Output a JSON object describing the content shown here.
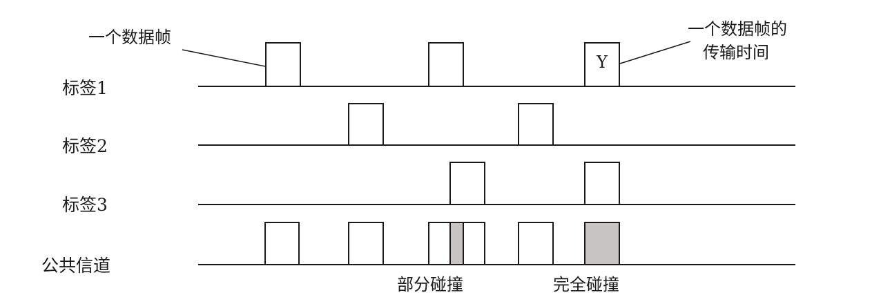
{
  "annotations": {
    "frame_label": "一个数据帧",
    "transmission_time_line1": "一个数据帧的",
    "transmission_time_line2": "传输时间",
    "frame_letter": "Y",
    "partial_collision": "部分碰撞",
    "full_collision": "完全碰撞"
  },
  "rows": [
    {
      "label": "标签1",
      "frames": [
        {
          "slot": "A"
        },
        {
          "slot": "C"
        },
        {
          "slot": "E",
          "letter": true
        }
      ]
    },
    {
      "label": "标签2",
      "frames": [
        {
          "slot": "B"
        },
        {
          "slot": "D"
        }
      ]
    },
    {
      "label": "标签3",
      "frames": [
        {
          "slot": "C2"
        },
        {
          "slot": "E"
        }
      ]
    },
    {
      "label": "公共信道",
      "frames": [
        {
          "slot": "A"
        },
        {
          "slot": "B"
        },
        {
          "slot": "C"
        },
        {
          "slot": "C2"
        },
        {
          "slot": "D"
        },
        {
          "slot": "E",
          "collision": true
        }
      ],
      "overlap_between": [
        "C",
        "C2"
      ]
    }
  ],
  "colors": {
    "ink": "#1a1a1a",
    "collision_fill": "#c9c4c4",
    "background": "#ffffff"
  }
}
